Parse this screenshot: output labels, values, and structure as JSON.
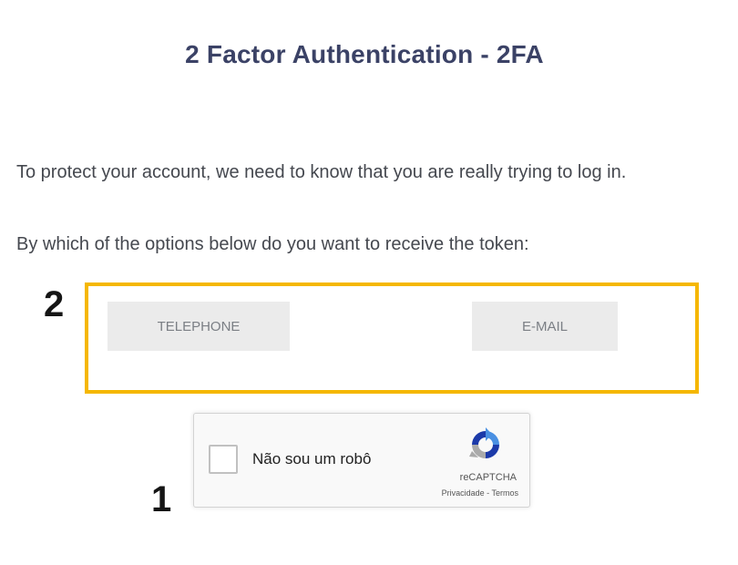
{
  "page": {
    "title": "2 Factor Authentication - 2FA",
    "intro_text": "To protect your account, we need to know that you are really trying to log in.",
    "question_text": "By which of the options below do you want to receive the token:"
  },
  "options": {
    "telephone_label": "TELEPHONE",
    "email_label": "E-MAIL"
  },
  "annotations": {
    "marker_options": "2",
    "marker_captcha": "1",
    "highlight_color": "#f5b700"
  },
  "recaptcha": {
    "checkbox_label": "Não sou um robô",
    "brand": "reCAPTCHA",
    "privacy_link": "Privacidade",
    "separator": " - ",
    "terms_link": "Termos",
    "logo_icon": "recaptcha-logo-icon"
  }
}
